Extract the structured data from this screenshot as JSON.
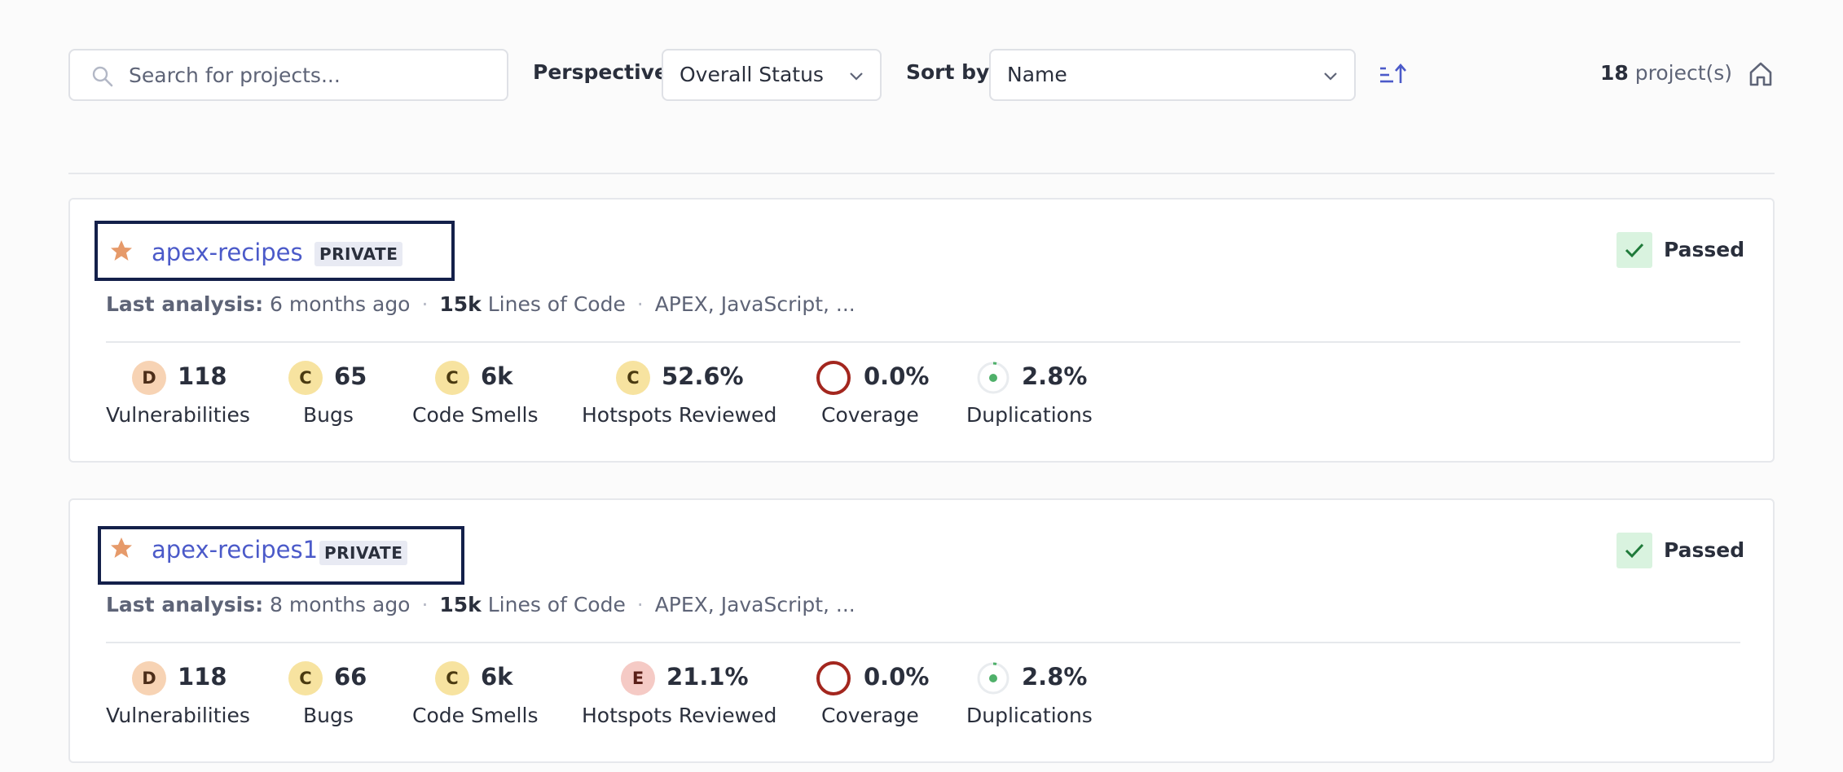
{
  "search": {
    "placeholder": "Search for projects..."
  },
  "perspective": {
    "label": "Perspective",
    "value": "Overall Status"
  },
  "sort": {
    "label": "Sort by",
    "value": "Name"
  },
  "summary": {
    "count": "18",
    "suffix": " project(s)"
  },
  "projects": [
    {
      "name": "apex-recipes",
      "visibility": "PRIVATE",
      "quality_gate": "Passed",
      "last_analysis_label": "Last analysis:",
      "last_analysis": "6 months ago",
      "loc_value": "15k",
      "loc_label": "Lines of Code",
      "languages": "APEX, JavaScript, ...",
      "measures": {
        "vulnerabilities": {
          "rating": "D",
          "value": "118",
          "label": "Vulnerabilities"
        },
        "bugs": {
          "rating": "C",
          "value": "65",
          "label": "Bugs"
        },
        "code_smells": {
          "rating": "C",
          "value": "6k",
          "label": "Code Smells"
        },
        "hotspots": {
          "rating": "C",
          "value": "52.6%",
          "label": "Hotspots Reviewed"
        },
        "coverage": {
          "value": "0.0%",
          "label": "Coverage"
        },
        "duplications": {
          "value": "2.8%",
          "label": "Duplications"
        }
      }
    },
    {
      "name": "apex-recipes1",
      "visibility": "PRIVATE",
      "quality_gate": "Passed",
      "last_analysis_label": "Last analysis:",
      "last_analysis": "8 months ago",
      "loc_value": "15k",
      "loc_label": "Lines of Code",
      "languages": "APEX, JavaScript, ...",
      "measures": {
        "vulnerabilities": {
          "rating": "D",
          "value": "118",
          "label": "Vulnerabilities"
        },
        "bugs": {
          "rating": "C",
          "value": "66",
          "label": "Bugs"
        },
        "code_smells": {
          "rating": "C",
          "value": "6k",
          "label": "Code Smells"
        },
        "hotspots": {
          "rating": "E",
          "value": "21.1%",
          "label": "Hotspots Reviewed"
        },
        "coverage": {
          "value": "0.0%",
          "label": "Coverage"
        },
        "duplications": {
          "value": "2.8%",
          "label": "Duplications"
        }
      }
    }
  ],
  "colors": {
    "accent": "#4b5ac9",
    "star": "#e69a6a",
    "passed_bg": "#d9f3df",
    "passed_check": "#1f7a3a",
    "coverage_ring": "#a3261e",
    "duplication_dot": "#4fb06a",
    "highlight_box": "#14204a"
  },
  "icons": {
    "search": "search-icon",
    "chevron": "chevron-down-icon",
    "sort_direction": "sort-ascending-icon",
    "home": "home-icon",
    "favorite": "star-icon",
    "quality_gate": "check-icon"
  }
}
